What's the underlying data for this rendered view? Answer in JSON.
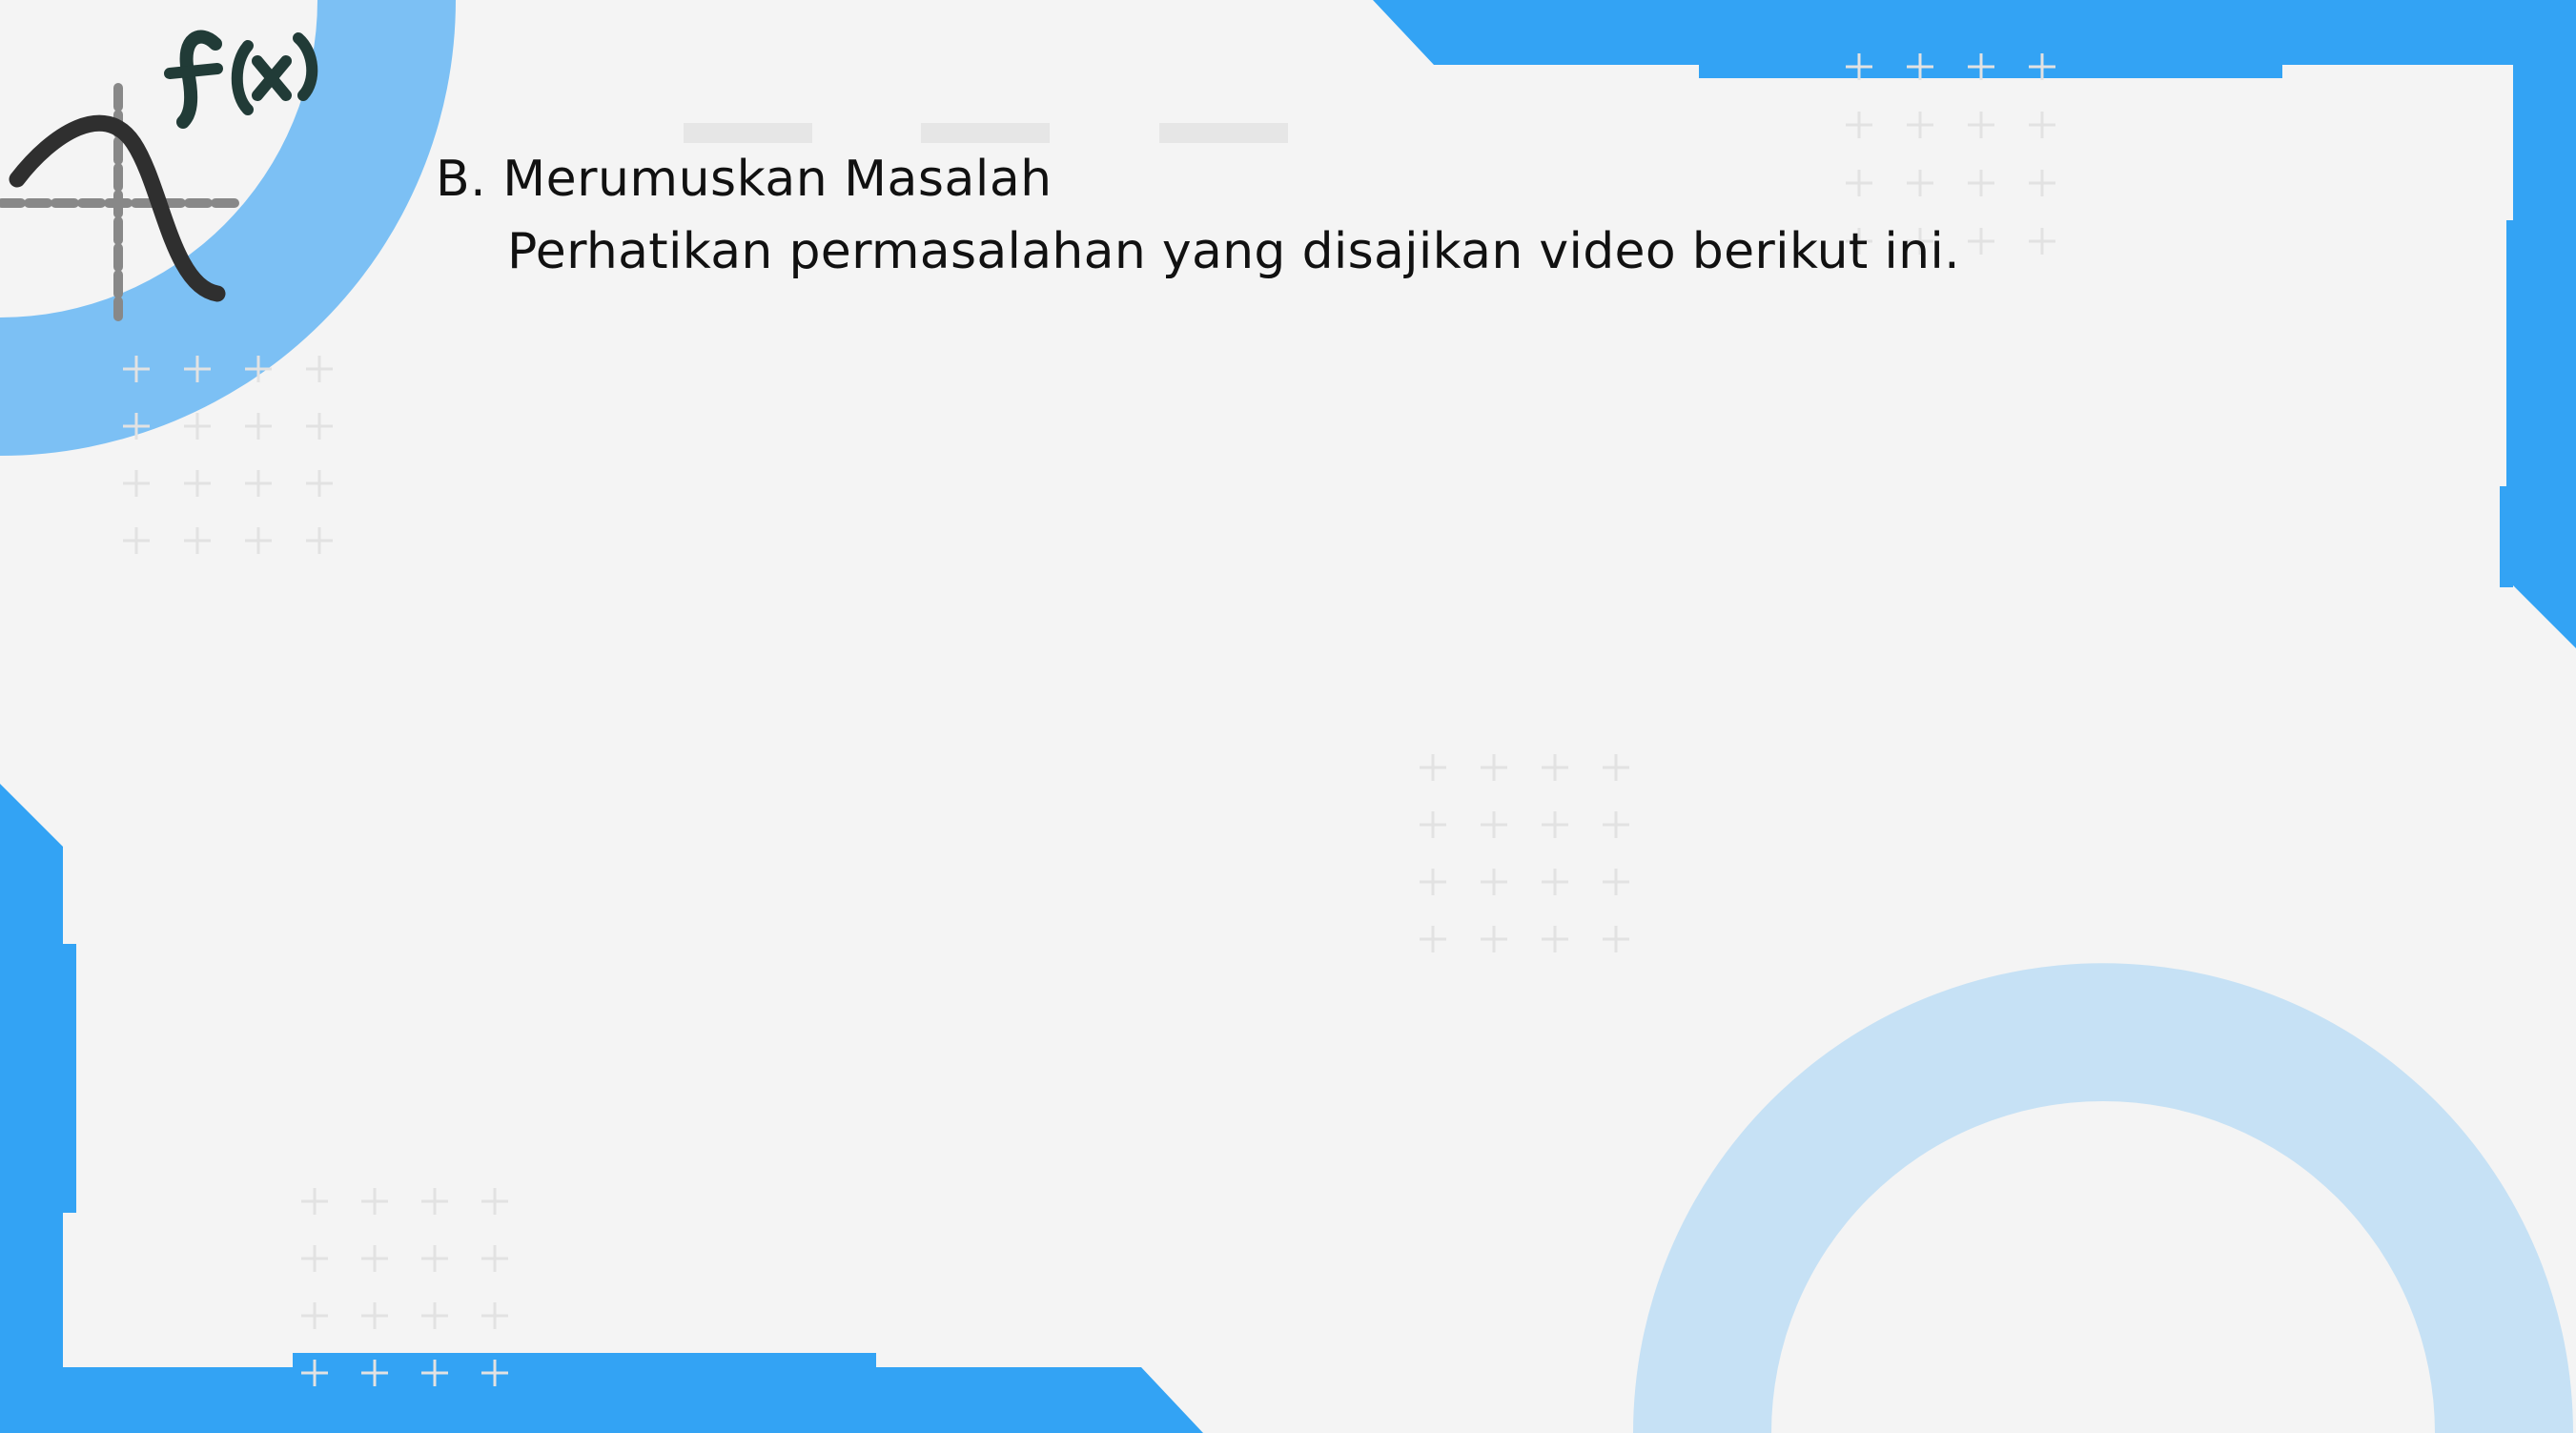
{
  "slide": {
    "heading": "B. Merumuskan Masalah",
    "subtext": "Perhatikan permasalahan yang disajikan video berikut ini.",
    "logo_text": "f(x)"
  },
  "colors": {
    "background": "#f4f4f4",
    "frame_blue": "#33a3f4",
    "ring_blue": "#7cc0f4",
    "ring_pale": "#c6e1f5",
    "plus_gray": "#e2e2e2",
    "dash_gray": "#e6e6e6",
    "logo_curve": "#2f2f2f",
    "logo_axis": "#888888"
  },
  "icons": {
    "logo": "function-graph-icon",
    "pattern": "plus-grid-pattern"
  }
}
